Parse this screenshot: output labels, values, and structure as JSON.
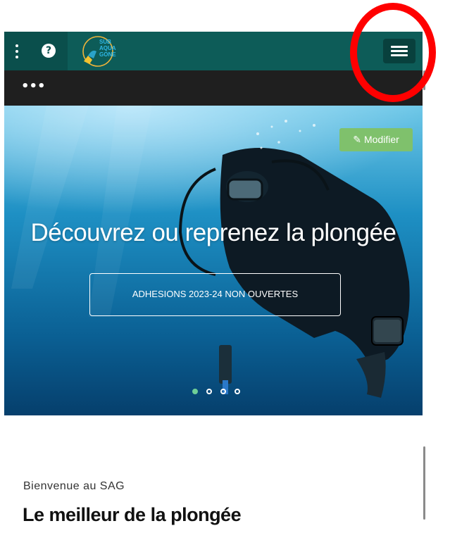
{
  "header": {
    "menu_icon": "kebab-menu-icon",
    "help_icon": "help-icon",
    "help_glyph": "?",
    "logo": {
      "line1": "SUB",
      "line2": "AQUA",
      "line3": "GONE"
    },
    "hamburger_icon": "hamburger-menu-icon"
  },
  "subbar": {
    "ellipsis": "•••"
  },
  "hero": {
    "edit_label": "Modifier",
    "edit_icon": "pencil-icon",
    "title": "Découvrez ou reprenez la plongée",
    "cta_label": "ADHESIONS 2023-24 NON OUVERTES",
    "slides_total": 4,
    "slide_active": 1
  },
  "content": {
    "welcome": "Bienvenue au SAG",
    "heading": "Le meilleur de la plongée"
  },
  "colors": {
    "header_bg": "#0d5c58",
    "subbar_bg": "#1f1f1f",
    "edit_button": "#7fc16c",
    "annotation": "#ff0000"
  }
}
